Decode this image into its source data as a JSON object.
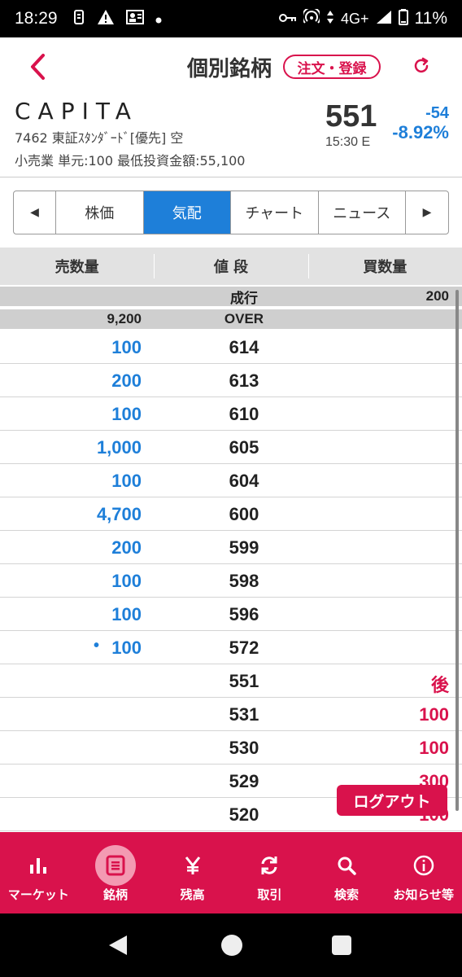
{
  "status_bar": {
    "time": "18:29",
    "network": "4G+",
    "battery": "11%"
  },
  "header": {
    "title": "個別銘柄",
    "order_button": "注文・登録"
  },
  "stock": {
    "name": "CAPITA",
    "code_line": "7462 東証ｽﾀﾝﾀﾞｰﾄﾞ[優先] 空",
    "meta_line": "小売業 単元:100 最低投資金額:55,100",
    "price": "551",
    "time": "15:30 E",
    "change": "-54",
    "change_pct": "-8.92%"
  },
  "tabs": {
    "prev_label": "◀",
    "next_label": "▶",
    "items": [
      {
        "label": "株価"
      },
      {
        "label": "気配"
      },
      {
        "label": "チャート"
      },
      {
        "label": "ニュース"
      }
    ]
  },
  "book": {
    "headers": {
      "sell": "売数量",
      "price": "値 段",
      "buy": "買数量"
    },
    "market_row": {
      "sell": "",
      "price": "成行",
      "buy": "200"
    },
    "over_row": {
      "sell": "9,200",
      "price": "OVER",
      "buy": ""
    },
    "rows": [
      {
        "sell": "100",
        "price": "614",
        "buy": ""
      },
      {
        "sell": "200",
        "price": "613",
        "buy": ""
      },
      {
        "sell": "100",
        "price": "610",
        "buy": ""
      },
      {
        "sell": "1,000",
        "price": "605",
        "buy": ""
      },
      {
        "sell": "100",
        "price": "604",
        "buy": ""
      },
      {
        "sell": "4,700",
        "price": "600",
        "buy": ""
      },
      {
        "sell": "200",
        "price": "599",
        "buy": ""
      },
      {
        "sell": "100",
        "price": "598",
        "buy": ""
      },
      {
        "sell": "100",
        "price": "596",
        "buy": ""
      },
      {
        "sell": "100",
        "price": "572",
        "buy": "",
        "marker": "•"
      },
      {
        "sell": "",
        "price": "551",
        "buy": "後"
      },
      {
        "sell": "",
        "price": "531",
        "buy": "100"
      },
      {
        "sell": "",
        "price": "530",
        "buy": "100"
      },
      {
        "sell": "",
        "price": "529",
        "buy": "300"
      },
      {
        "sell": "",
        "price": "520",
        "buy": "100"
      }
    ]
  },
  "logout_label": "ログアウト",
  "bottom_nav": [
    {
      "label": "マーケット",
      "icon": "bar-chart-icon"
    },
    {
      "label": "銘柄",
      "icon": "list-icon"
    },
    {
      "label": "残高",
      "icon": "yen-icon"
    },
    {
      "label": "取引",
      "icon": "refresh-arrows-icon"
    },
    {
      "label": "検索",
      "icon": "search-icon"
    },
    {
      "label": "お知らせ等",
      "icon": "info-icon"
    }
  ],
  "colors": {
    "brand": "#d9124c",
    "active_tab": "#1e7fd9",
    "sell_qty": "#1e7fd9",
    "buy_qty": "#d9124c"
  }
}
